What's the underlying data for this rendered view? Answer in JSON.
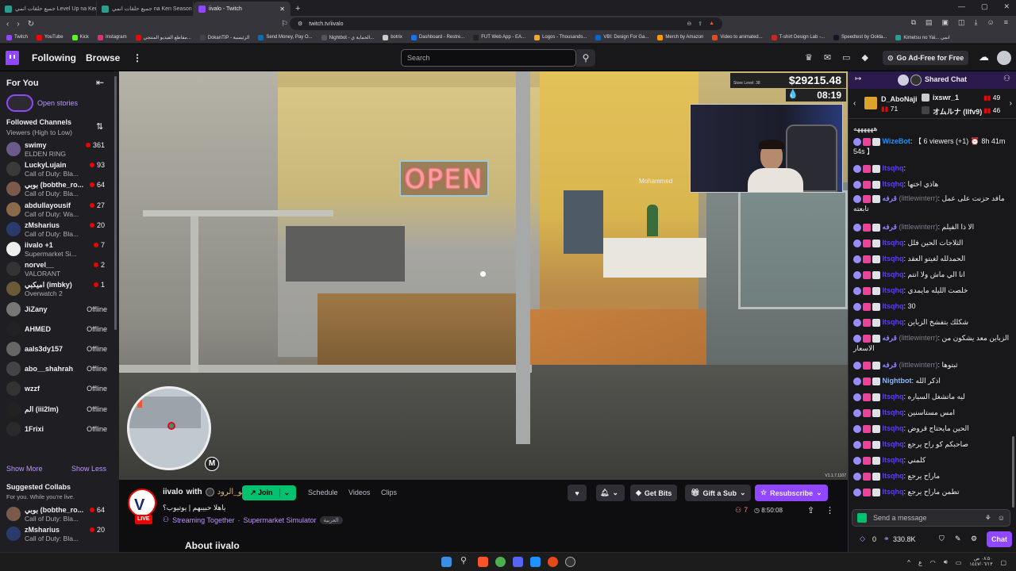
{
  "browser": {
    "tabs": [
      {
        "title": "جميع حلقات انمي Level Up na Ken",
        "active": false
      },
      {
        "title": "جميع حلقات انمي na Ken Season 2",
        "active": false
      },
      {
        "title": "iivalo - Twitch",
        "active": true
      }
    ],
    "new_tab": "+",
    "url": "twitch.tv/iivalo",
    "bookmarks": [
      {
        "label": "Twitch",
        "color": "#9147ff"
      },
      {
        "label": "YouTube",
        "color": "#ff0000"
      },
      {
        "label": "Kick",
        "color": "#53fc18"
      },
      {
        "label": "Instagram",
        "color": "#e1306c"
      },
      {
        "label": "مقاطع الفيديو المنتجي...",
        "color": "#ff0000"
      },
      {
        "label": "DokanTIP - الرئيسية",
        "color": "#444"
      },
      {
        "label": "Send Money, Pay O...",
        "color": "#0070ba"
      },
      {
        "label": "Nightbot - الحماية ي...",
        "color": "#555"
      },
      {
        "label": "botrix",
        "color": "#ccc"
      },
      {
        "label": "Dashboard - Restre...",
        "color": "#1a73e8"
      },
      {
        "label": "FUT Web App - EA...",
        "color": "#222"
      },
      {
        "label": "Logos - Thousands...",
        "color": "#f5a623"
      },
      {
        "label": "VBI: Design For Ga...",
        "color": "#0a66c2"
      },
      {
        "label": "Merch by Amazon",
        "color": "#ff9900"
      },
      {
        "label": "Video to animated...",
        "color": "#e64a19"
      },
      {
        "label": "T-shirt Design Lab -...",
        "color": "#c62828"
      },
      {
        "label": "Speedtest by Ookla...",
        "color": "#141526"
      },
      {
        "label": "Kimetsu no Yai... انمي",
        "color": "#2a9d8f"
      }
    ]
  },
  "nav": {
    "following": "Following",
    "browse": "Browse",
    "more": "⋮",
    "search_placeholder": "Search",
    "ad_free": "Go Ad-Free for Free"
  },
  "sidebar": {
    "for_you": "For You",
    "open_stories": "Open stories",
    "followed_channels": "Followed Channels",
    "sort": "Viewers (High to Low)",
    "channels": [
      {
        "name": "swimy",
        "game": "ELDEN RING",
        "viewers": "361",
        "live": true,
        "color": "#6b5a8a"
      },
      {
        "name": "LuckyLujain",
        "game": "Call of Duty: Bla...",
        "viewers": "93",
        "live": true,
        "color": "#3a3a3a"
      },
      {
        "name": "بوبي (bobthe_ro...",
        "game": "Call of Duty: Bla...",
        "viewers": "64",
        "live": true,
        "color": "#7a5a4a"
      },
      {
        "name": "abdullayousif",
        "game": "Call of Duty: Wa...",
        "viewers": "27",
        "live": true,
        "color": "#8a6a4a"
      },
      {
        "name": "zMsharius",
        "game": "Call of Duty: Bla...",
        "viewers": "20",
        "live": true,
        "color": "#2a3a6a"
      },
      {
        "name": "iivalo +1",
        "game": "Supermarket Si...",
        "viewers": "7",
        "live": true,
        "color": "#eeeeee"
      },
      {
        "name": "norvel__",
        "game": "VALORANT",
        "viewers": "2",
        "live": true,
        "color": "#333"
      },
      {
        "name": "اميكبي (imbky)",
        "game": "Overwatch 2",
        "viewers": "1",
        "live": true,
        "color": "#6a5a3a"
      },
      {
        "name": "JiZany",
        "status": "Offline",
        "live": false,
        "color": "#777"
      },
      {
        "name": "AHMED",
        "status": "Offline",
        "live": false,
        "color": "#222"
      },
      {
        "name": "aals3dy157",
        "status": "Offline",
        "live": false,
        "color": "#666"
      },
      {
        "name": "abo__shahrah",
        "status": "Offline",
        "live": false,
        "color": "#444"
      },
      {
        "name": "wzzf",
        "status": "Offline",
        "live": false,
        "color": "#333"
      },
      {
        "name": "الم (iii2lm)",
        "status": "Offline",
        "live": false,
        "color": "#222"
      },
      {
        "name": "1Frixi",
        "status": "Offline",
        "live": false,
        "color": "#2a2a2a"
      }
    ],
    "show_more": "Show More",
    "show_less": "Show Less",
    "suggested_collabs": "Suggested Collabs",
    "collab_sub": "For you. While you're live.",
    "collabs": [
      {
        "name": "بوبي (bobthe_ro...",
        "game": "Call of Duty: Bla...",
        "viewers": "64",
        "color": "#7a5a4a"
      },
      {
        "name": "zMsharius",
        "game": "Call of Duty: Bla...",
        "viewers": "20",
        "color": "#2a3a6a"
      }
    ]
  },
  "video": {
    "sign": "OPEN",
    "money": "$29215.48",
    "store_level": "Store Level: 38",
    "time": "08:19",
    "npc_label": "Mohammed",
    "minimap_key": "M",
    "version": "V1.1.7.1107"
  },
  "channel": {
    "name": "iivalo",
    "with": "with",
    "coname": "أبو_الرود",
    "join": "Join",
    "tabs": [
      "Schedule",
      "Videos",
      "Clips"
    ],
    "live": "LIVE",
    "title": "ياهلا حبيبهم | يوتيوب؟",
    "tag1": "Streaming Together",
    "tag2": "Supermarket Simulator",
    "lang": "العربية",
    "get_bits": "Get Bits",
    "gift_sub": "Gift a Sub",
    "resubscribe": "Resubscribe",
    "viewers": "7",
    "uptime": "8:50:08",
    "about": "About iivalo"
  },
  "chat": {
    "header": "Shared Chat",
    "gifters": [
      {
        "name": "D_AboNaji",
        "count": "71"
      },
      {
        "name": "ixswr_1",
        "count": "49"
      },
      {
        "name": "オムルナ (llfv9)",
        "count": "46"
      }
    ],
    "messages": [
      {
        "user": "",
        "text": "ههههههه",
        "color": "#ccc"
      },
      {
        "user": "WizeBot",
        "text": ": 【 6 viewers (+1) ⏰ 8h 41m 54s 】",
        "color": "#1e90ff"
      },
      {
        "user": "Itsqhq",
        "text": ":",
        "color": "#5c3cff"
      },
      {
        "user": "Itsqhq",
        "text": ": هاذي اختها",
        "color": "#5c3cff"
      },
      {
        "user": "قرفه",
        "sub": "(littlewinterr)",
        "text": ": مافد حزنت على عمل تابعته",
        "color": "#8a7fff"
      },
      {
        "user": "قرفه",
        "sub": "(littlewinterr)",
        "text": ": الا ذا الفيلم",
        "color": "#8a7fff"
      },
      {
        "user": "Itsqhq",
        "text": ": الثلاجات الحين فلل",
        "color": "#5c3cff"
      },
      {
        "user": "Itsqhq",
        "text": ": الحمدلله لغيتو العقد",
        "color": "#5c3cff"
      },
      {
        "user": "Itsqhq",
        "text": ": انا الي ماش ولا انتم",
        "color": "#5c3cff"
      },
      {
        "user": "Itsqhq",
        "text": ": خلصت الليله مايمدي",
        "color": "#5c3cff"
      },
      {
        "user": "Itsqhq",
        "text": ": 30",
        "color": "#5c3cff"
      },
      {
        "user": "Itsqhq",
        "text": ": شكلك بتفشخ الزباين",
        "color": "#5c3cff"
      },
      {
        "user": "قرفه",
        "sub": "(littlewinterr)",
        "text": ": الزباين معد يشكون من الاسعار",
        "color": "#8a7fff"
      },
      {
        "user": "قرفه",
        "sub": "(littlewinterr)",
        "text": ": ثبتوها",
        "color": "#8a7fff"
      },
      {
        "user": "Nightbot",
        "text": ": اذكر الله",
        "color": "#8bb8ff"
      },
      {
        "user": "Itsqhq",
        "text": ": ليه ماتشغل السياره",
        "color": "#5c3cff"
      },
      {
        "user": "Itsqhq",
        "text": ": امس مستاسنين",
        "color": "#5c3cff"
      },
      {
        "user": "Itsqhq",
        "text": ": الحين مايحتاج قروض",
        "color": "#5c3cff"
      },
      {
        "user": "Itsqhq",
        "text": ": صاحبكم كو راح يرجع",
        "color": "#5c3cff"
      },
      {
        "user": "Itsqhq",
        "text": ": كلمني",
        "color": "#5c3cff"
      },
      {
        "user": "Itsqhq",
        "text": ": ماراح يرجع",
        "color": "#5c3cff"
      },
      {
        "user": "Itsqhq",
        "text": ": تطمن ماراح يرجع",
        "color": "#5c3cff"
      }
    ],
    "input_placeholder": "Send a message",
    "points": "0",
    "bits": "330.8K",
    "chat_button": "Chat"
  },
  "taskbar": {
    "lang": "ع",
    "time": "٠٨:٥٠ ص",
    "date": "١٤٤٧/٠٦/١٣"
  }
}
